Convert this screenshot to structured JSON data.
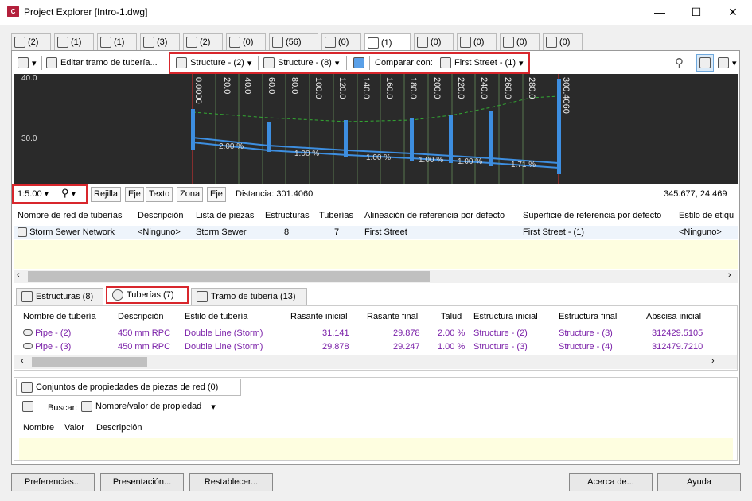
{
  "window": {
    "title": "Project Explorer [Intro-1.dwg]",
    "app_badge": "C",
    "minimize": "—",
    "maximize": "☐",
    "close": "✕"
  },
  "tabs": [
    {
      "count": "(2)"
    },
    {
      "count": "(1)"
    },
    {
      "count": "(1)"
    },
    {
      "count": "(3)"
    },
    {
      "count": "(2)"
    },
    {
      "count": "(0)"
    },
    {
      "count": "(56)"
    },
    {
      "count": "(0)"
    },
    {
      "count": "(1)"
    },
    {
      "count": "(0)"
    },
    {
      "count": "(0)"
    },
    {
      "count": "(0)"
    },
    {
      "count": "(0)"
    }
  ],
  "toolbar": {
    "edit_run": "Editar tramo de tubería...",
    "structure_a": "Structure - (2)",
    "structure_b": "Structure - (8)",
    "compare_label": "Comparar con:",
    "compare_value": "First Street - (1)"
  },
  "profile": {
    "y_labels": [
      "40.0",
      "30.0"
    ],
    "stations": [
      "0.0000",
      "20.0",
      "40.0",
      "60.0",
      "80.0",
      "100.0",
      "120.0",
      "140.0",
      "160.0",
      "180.0",
      "200.0",
      "220.0",
      "240.0",
      "260.0",
      "280.0",
      "300.4060"
    ],
    "slopes": [
      "2.00 %",
      "1.00 %",
      "1.00 %",
      "1.00 %",
      "1.00 %",
      "1.71 %"
    ]
  },
  "controls": {
    "scale": "1:5.00",
    "grid": "Rejilla",
    "axis1": "Eje",
    "text": "Texto",
    "zone": "Zona",
    "axis2": "Eje",
    "distance": "Distancia: 301.4060",
    "coords": "345.677, 24.469"
  },
  "network_table": {
    "headers": [
      "Nombre de red de tuberías",
      "Descripción",
      "Lista de piezas",
      "Estructuras",
      "Tuberías",
      "Alineación de referencia por defecto",
      "Superficie de referencia por defecto",
      "Estilo de etiqu"
    ],
    "row": [
      "Storm Sewer Network",
      "<Ninguno>",
      "Storm Sewer",
      "8",
      "7",
      "First Street",
      "First Street - (1)",
      "<Ninguno>"
    ]
  },
  "bottom_tabs": {
    "structures": "Estructuras (8)",
    "pipes": "Tuberías (7)",
    "runs": "Tramo de tubería (13)"
  },
  "pipes_table": {
    "headers": [
      "Nombre de tubería",
      "Descripción",
      "Estilo de tubería",
      "Rasante inicial",
      "Rasante final",
      "Talud",
      "Estructura inicial",
      "Estructura final",
      "Abscisa inicial"
    ],
    "rows": [
      [
        "Pipe - (2)",
        "450 mm RPC",
        "Double Line (Storm)",
        "31.141",
        "29.878",
        "2.00 %",
        "Structure - (2)",
        "Structure - (3)",
        "312429.5105"
      ],
      [
        "Pipe - (3)",
        "450 mm RPC",
        "Double Line (Storm)",
        "29.878",
        "29.247",
        "1.00 %",
        "Structure - (3)",
        "Structure - (4)",
        "312479.7210"
      ]
    ]
  },
  "property_sets": {
    "tab": "Conjuntos de propiedades de piezas de red (0)",
    "search_label": "Buscar:",
    "search_mode": "Nombre/valor de propiedad",
    "headers": [
      "Nombre",
      "Valor",
      "Descripción"
    ]
  },
  "buttons": {
    "prefs": "Preferencias...",
    "presentation": "Presentación...",
    "reset": "Restablecer...",
    "about": "Acerca de...",
    "help": "Ayuda"
  }
}
